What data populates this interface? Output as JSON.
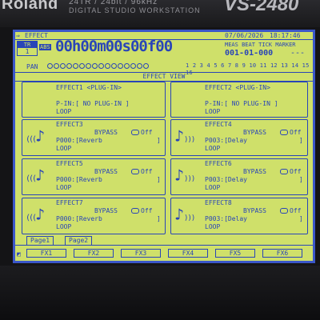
{
  "bezel": {
    "brand": "Roland",
    "spec_line1": "24TR / 24bit / 96kHz",
    "spec_line2": "DIGITAL STUDIO WORKSTATION",
    "model": "VS-2480"
  },
  "header": {
    "screen_name": "EFFECT",
    "date": "07/06/2026",
    "time_of_day": "18:17:46",
    "track_label": "TR",
    "track_value": "1",
    "abs_badge": "ABS",
    "timecode": "00h00m00s00f00",
    "meas_beat_label": "MEAS BEAT TICK MARKER",
    "meas_beat_value": "001-01-000",
    "marker_value": "---",
    "pan_label": "PAN",
    "channel_numbers": "1 2 3 4 5 6 7 8 9 10 11 12 13 14 15 16"
  },
  "view_title": "EFFECT VIEW",
  "plugin_effects": [
    {
      "title": "EFFECT1 <PLUG-IN>",
      "pin": "P-IN:[ NO PLUG-IN ]",
      "mode": "LOOP"
    },
    {
      "title": "EFFECT2 <PLUG-IN>",
      "pin": "P-IN:[ NO PLUG-IN ]",
      "mode": "LOOP"
    }
  ],
  "effects": [
    {
      "title": "EFFECT3",
      "bypass_label": "BYPASS",
      "bypass_state": "Off",
      "patch": "P000:[Reverb",
      "patch_end": "]",
      "mode": "LOOP"
    },
    {
      "title": "EFFECT4",
      "bypass_label": "BYPASS",
      "bypass_state": "Off",
      "patch": "P003:[Delay",
      "patch_end": "]",
      "mode": "LOOP"
    },
    {
      "title": "EFFECT5",
      "bypass_label": "BYPASS",
      "bypass_state": "Off",
      "patch": "P000:[Reverb",
      "patch_end": "]",
      "mode": "LOOP"
    },
    {
      "title": "EFFECT6",
      "bypass_label": "BYPASS",
      "bypass_state": "Off",
      "patch": "P003:[Delay",
      "patch_end": "]",
      "mode": "LOOP"
    },
    {
      "title": "EFFECT7",
      "bypass_label": "BYPASS",
      "bypass_state": "Off",
      "patch": "P000:[Reverb",
      "patch_end": "]",
      "mode": "LOOP"
    },
    {
      "title": "EFFECT8",
      "bypass_label": "BYPASS",
      "bypass_state": "Off",
      "patch": "P003:[Delay",
      "patch_end": "]",
      "mode": "LOOP"
    }
  ],
  "tabs": [
    "Page1",
    "Page2"
  ],
  "function_keys": [
    "FX1",
    "FX2",
    "FX3",
    "FX4",
    "FX5",
    "FX6"
  ],
  "colors": {
    "lcd_background": "#cfe06a",
    "lcd_foreground": "#2945b8",
    "bezel": "#141416"
  }
}
